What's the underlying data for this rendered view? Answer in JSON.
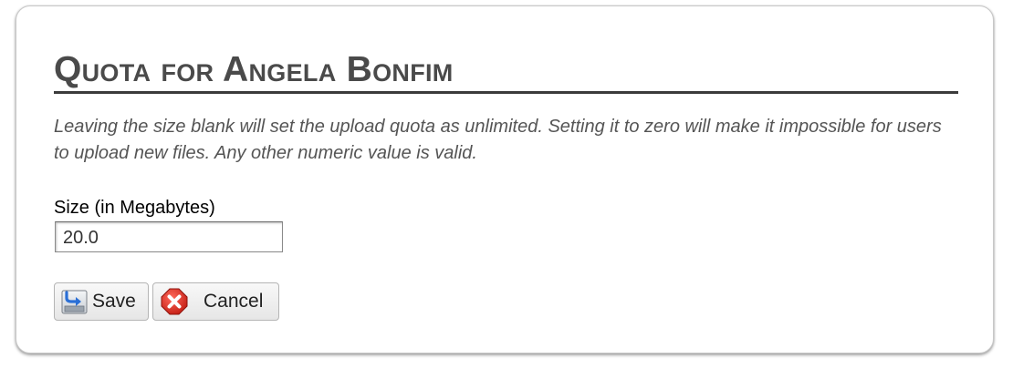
{
  "dialog": {
    "title": "Quota for Angela Bonfim",
    "description": "Leaving the size blank will set the upload quota as unlimited. Setting it to zero will make it impossible for users to upload new files. Any other numeric value is valid.",
    "size_field": {
      "label": "Size (in Megabytes)",
      "value": "20.0"
    },
    "buttons": {
      "save_label": "Save",
      "save_icon": "save-icon",
      "cancel_label": "Cancel",
      "cancel_icon": "cancel-icon"
    }
  },
  "colors": {
    "title": "#4a4a4a",
    "rule": "#3b3b3b",
    "description": "#555555",
    "cancel_red": "#d42a1f"
  }
}
